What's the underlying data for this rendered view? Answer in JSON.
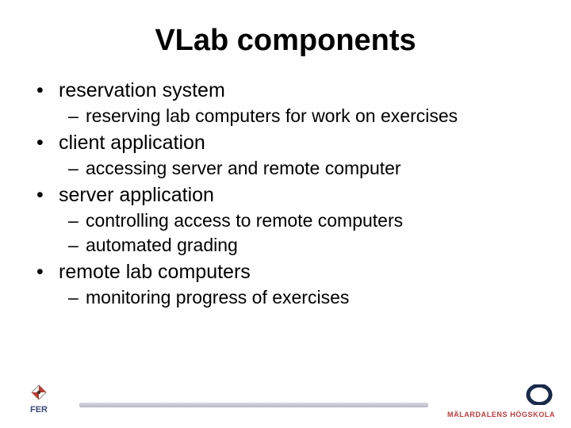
{
  "title": "VLab components",
  "bullets": [
    {
      "text": "reservation system",
      "sub": [
        "reserving lab computers for work on exercises"
      ]
    },
    {
      "text": "client application",
      "sub": [
        "accessing server and remote computer"
      ]
    },
    {
      "text": "server application",
      "sub": [
        "controlling access to remote computers",
        "automated grading"
      ]
    },
    {
      "text": "remote lab computers",
      "sub": [
        "monitoring progress of exercises"
      ]
    }
  ],
  "footer": {
    "left_logo": "FER",
    "right_logo_text": "MÄLARDALENS HÖGSKOLA"
  }
}
